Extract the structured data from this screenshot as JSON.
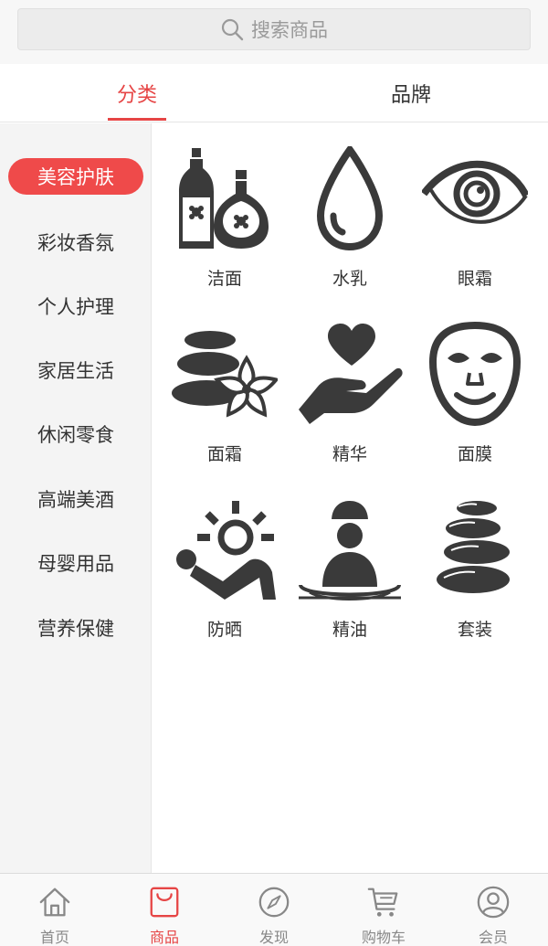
{
  "search": {
    "placeholder": "搜索商品",
    "icon": "search-icon"
  },
  "tabs": [
    {
      "label": "分类",
      "active": true
    },
    {
      "label": "品牌",
      "active": false
    }
  ],
  "sidebar": {
    "items": [
      {
        "label": "美容护肤",
        "active": true
      },
      {
        "label": "彩妆香氛"
      },
      {
        "label": "个人护理"
      },
      {
        "label": "家居生活"
      },
      {
        "label": "休闲零食"
      },
      {
        "label": "高端美酒"
      },
      {
        "label": "母婴用品"
      },
      {
        "label": "营养保健"
      }
    ]
  },
  "grid": {
    "items": [
      {
        "label": "洁面",
        "icon": "bottles-icon"
      },
      {
        "label": "水乳",
        "icon": "drop-icon"
      },
      {
        "label": "眼霜",
        "icon": "eye-icon"
      },
      {
        "label": "面霜",
        "icon": "spa-stones-flower-icon"
      },
      {
        "label": "精华",
        "icon": "heart-hand-icon"
      },
      {
        "label": "面膜",
        "icon": "face-mask-icon"
      },
      {
        "label": "防晒",
        "icon": "sunbathing-icon"
      },
      {
        "label": "精油",
        "icon": "spa-person-icon"
      },
      {
        "label": "套装",
        "icon": "stacked-stones-icon"
      }
    ]
  },
  "nav": {
    "items": [
      {
        "label": "首页",
        "icon": "home-icon"
      },
      {
        "label": "商品",
        "icon": "shopping-bag-icon",
        "active": true
      },
      {
        "label": "发现",
        "icon": "compass-icon"
      },
      {
        "label": "购物车",
        "icon": "cart-icon"
      },
      {
        "label": "会员",
        "icon": "user-icon"
      }
    ]
  },
  "colors": {
    "accent": "#e64545",
    "icon_dark": "#3a3a3a"
  }
}
